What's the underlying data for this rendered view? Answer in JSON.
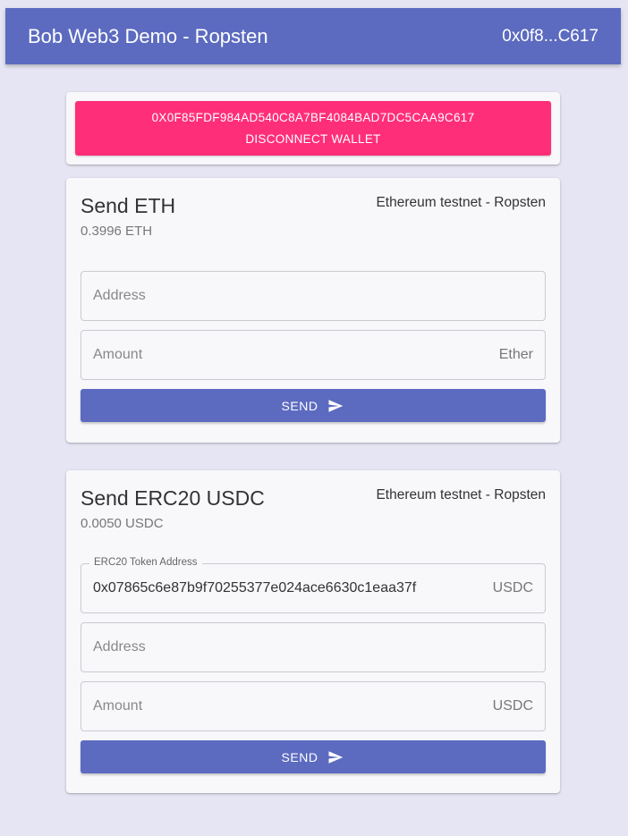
{
  "appbar": {
    "title": "Bob Web3 Demo - Ropsten",
    "account_short": "0x0f8...C617"
  },
  "wallet": {
    "address": "0X0F85FDF984AD540C8A7BF4084BAD7DC5CAA9C617",
    "disconnect_label": "DISCONNECT WALLET",
    "accent_color": "#ff2e78"
  },
  "send_eth": {
    "title": "Send ETH",
    "network": "Ethereum testnet - Ropsten",
    "balance": "0.3996 ETH",
    "address_placeholder": "Address",
    "amount_placeholder": "Amount",
    "amount_unit": "Ether",
    "send_label": "SEND",
    "send_icon": "send-icon"
  },
  "send_erc20": {
    "title": "Send ERC20 USDC",
    "network": "Ethereum testnet - Ropsten",
    "balance": "0.0050 USDC",
    "token_label": "ERC20 Token Address",
    "token_address": "0x07865c6e87b9f70255377e024ace6630c1eaa37f",
    "token_unit": "USDC",
    "address_placeholder": "Address",
    "amount_placeholder": "Amount",
    "amount_unit": "USDC",
    "send_label": "SEND",
    "send_icon": "send-icon"
  },
  "colors": {
    "primary": "#5c6bc0",
    "background": "#e6e5f3"
  }
}
